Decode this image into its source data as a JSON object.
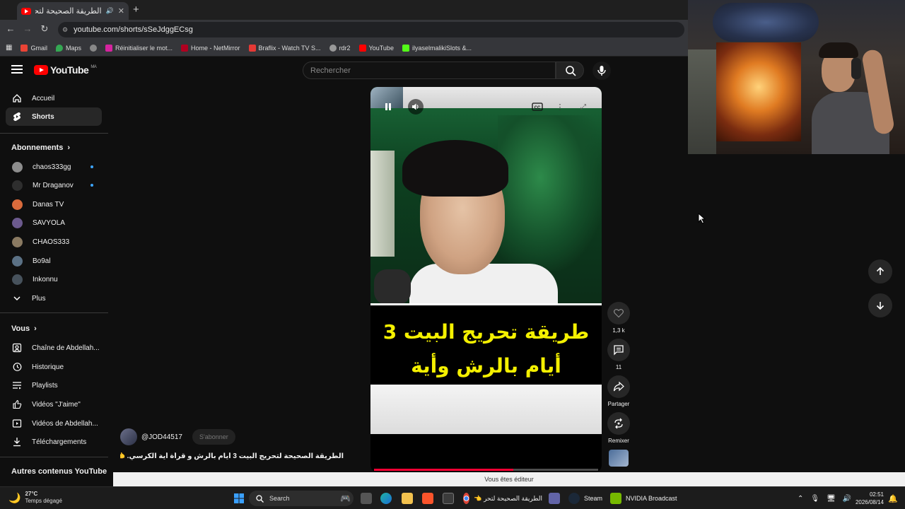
{
  "browser": {
    "tab_title": "الطريقة الصحيحة لتحريج 👈",
    "url": "youtube.com/shorts/sSeJdggECsg",
    "bookmarks": [
      "Gmail",
      "Maps",
      "Réinitialiser le mot...",
      "Home - NetMirror",
      "Braflix - Watch TV S...",
      "rdr2",
      "YouTube",
      "ilyaselmalikiSlots &..."
    ]
  },
  "youtube": {
    "logo": "YouTube",
    "logo_country": "MA",
    "search_placeholder": "Rechercher"
  },
  "sidebar": {
    "main": [
      {
        "label": "Accueil",
        "icon": "home-icon"
      },
      {
        "label": "Shorts",
        "icon": "shorts-icon",
        "active": true
      }
    ],
    "subscriptions_header": "Abonnements",
    "subscriptions": [
      {
        "label": "chaos333gg",
        "new": true
      },
      {
        "label": "Mr Draganov",
        "new": true
      },
      {
        "label": "Danas TV",
        "new": false
      },
      {
        "label": "SAVYOLA",
        "new": false
      },
      {
        "label": "CHAOS333",
        "new": false
      },
      {
        "label": "Bo9al",
        "new": false
      },
      {
        "label": "Inkonnu",
        "new": false
      },
      {
        "label": "Plus",
        "new": false
      }
    ],
    "you_header": "Vous",
    "you": [
      {
        "label": "Chaîne de Abdellah...",
        "icon": "channel-icon"
      },
      {
        "label": "Historique",
        "icon": "history-icon"
      },
      {
        "label": "Playlists",
        "icon": "playlist-icon"
      },
      {
        "label": "Vidéos \"J'aime\"",
        "icon": "thumbs-up-icon"
      },
      {
        "label": "Vidéos de Abdellah...",
        "icon": "video-icon"
      },
      {
        "label": "Téléchargements",
        "icon": "download-icon"
      }
    ],
    "more_header": "Autres contenus YouTube"
  },
  "short": {
    "caption_lines": [
      "طريقة تحريج البيت 3",
      "أيام بالرش وأية الكرسي"
    ],
    "progress": 0.62,
    "channel": "@JOD44517",
    "subscribe_label": "S'abonner",
    "title": "الطريقة الصحيحة لتحريج البيت 3 أيام بالرش و قرأة أية الكرسي. 👈 ...",
    "likes": "1,3 k",
    "comments": "11",
    "share_label": "Partager",
    "remix_label": "Remixer"
  },
  "editor_notice": "Vous êtes éditeur",
  "taskbar": {
    "weather_temp": "27°C",
    "weather_desc": "Temps dégagé",
    "search_label": "Search",
    "chrome_title": "الطريقة الصحيحة لتحر 👈",
    "steam_label": "Steam",
    "nvidia_label": "NVIDIA Broadcast",
    "time": "02:51",
    "date": "2026/08/14"
  },
  "colors": {
    "youtube_red": "#ff0000",
    "caption_yellow": "#f4f000",
    "progress_red": "#ff0033",
    "background": "#0f0f0f"
  }
}
